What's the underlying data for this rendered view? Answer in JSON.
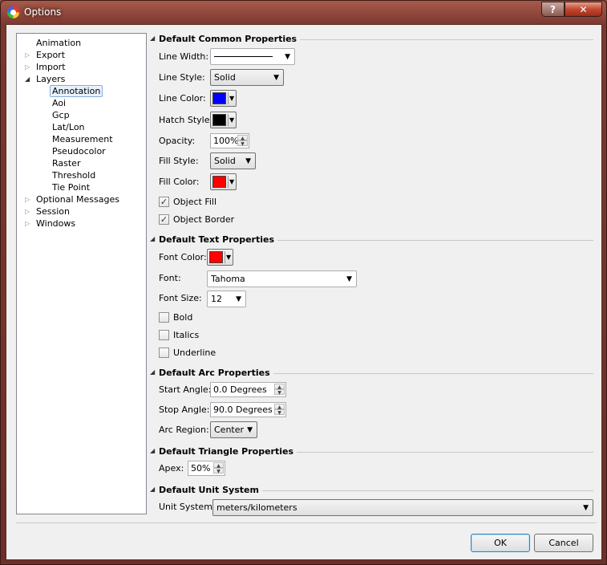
{
  "window": {
    "title": "Options",
    "help_label": "?",
    "close_label": "✕"
  },
  "tree": {
    "items": [
      {
        "label": "Animation",
        "arrow": ""
      },
      {
        "label": "Export",
        "arrow": "▷"
      },
      {
        "label": "Import",
        "arrow": "▷"
      },
      {
        "label": "Layers",
        "arrow": "◢"
      },
      {
        "label": "Annotation",
        "arrow": ""
      },
      {
        "label": "Aoi",
        "arrow": ""
      },
      {
        "label": "Gcp",
        "arrow": ""
      },
      {
        "label": "Lat/Lon",
        "arrow": ""
      },
      {
        "label": "Measurement",
        "arrow": ""
      },
      {
        "label": "Pseudocolor",
        "arrow": ""
      },
      {
        "label": "Raster",
        "arrow": ""
      },
      {
        "label": "Threshold",
        "arrow": ""
      },
      {
        "label": "Tie Point",
        "arrow": ""
      },
      {
        "label": "Optional Messages",
        "arrow": "▷"
      },
      {
        "label": "Session",
        "arrow": "▷"
      },
      {
        "label": "Windows",
        "arrow": "▷"
      }
    ],
    "selected": "Annotation"
  },
  "common": {
    "title": "Default Common Properties",
    "line_width_label": "Line Width:",
    "line_style_label": "Line Style:",
    "line_style_value": "Solid",
    "line_color_label": "Line Color:",
    "line_color": "#0000ff",
    "hatch_style_label": "Hatch Style:",
    "hatch_color": "#000000",
    "opacity_label": "Opacity:",
    "opacity_value": "100%",
    "fill_style_label": "Fill Style:",
    "fill_style_value": "Solid",
    "fill_color_label": "Fill Color:",
    "fill_color": "#ff0000",
    "object_fill_label": "Object Fill",
    "object_fill_checked": true,
    "object_border_label": "Object Border",
    "object_border_checked": true
  },
  "text": {
    "title": "Default Text Properties",
    "font_color_label": "Font Color:",
    "font_color": "#ff0000",
    "font_label": "Font:",
    "font_value": "Tahoma",
    "font_size_label": "Font Size:",
    "font_size_value": "12",
    "bold_label": "Bold",
    "italics_label": "Italics",
    "underline_label": "Underline"
  },
  "arc": {
    "title": "Default Arc Properties",
    "start_angle_label": "Start Angle:",
    "start_angle_value": "0.0 Degrees",
    "stop_angle_label": "Stop Angle:",
    "stop_angle_value": "90.0 Degrees",
    "arc_region_label": "Arc Region:",
    "arc_region_value": "Center"
  },
  "triangle": {
    "title": "Default Triangle Properties",
    "apex_label": "Apex:",
    "apex_value": "50%"
  },
  "unit": {
    "title": "Default Unit System",
    "unit_system_label": "Unit System:",
    "unit_system_value": "meters/kilometers"
  },
  "buttons": {
    "ok": "OK",
    "cancel": "Cancel"
  },
  "glyphs": {
    "dropdown": "▼",
    "check": "✓",
    "up": "▲",
    "down": "▼",
    "section_arrow": "◢"
  }
}
